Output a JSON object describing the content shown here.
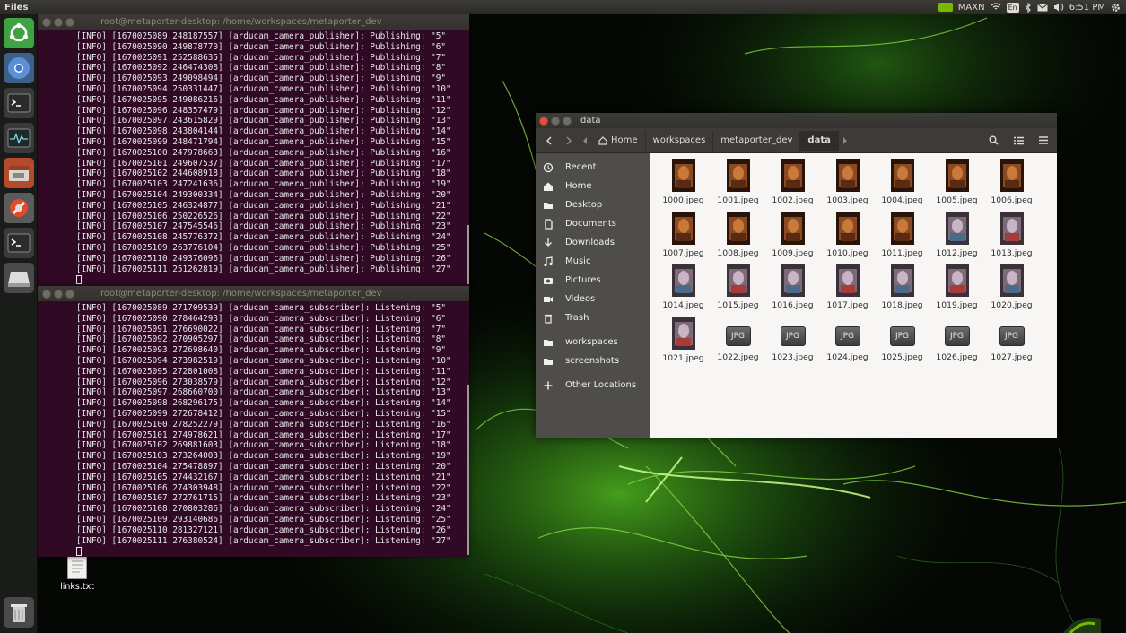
{
  "top_panel": {
    "app_name": "Files",
    "power_mode": "MAXN",
    "keyboard_layout": "En",
    "time": "6:51 PM"
  },
  "launcher": {
    "items": [
      {
        "name": "ubuntu-dash-icon",
        "color": "#3fa344"
      },
      {
        "name": "chromium-icon",
        "color": "#3d7bd9"
      },
      {
        "name": "terminal-icon",
        "color": "#2b2b2b"
      },
      {
        "name": "system-monitor-icon",
        "color": "#2b2b2b"
      },
      {
        "name": "files-icon",
        "color": "#d9613e"
      },
      {
        "name": "settings-icon",
        "color": "#e24a2a"
      },
      {
        "name": "terminal-icon-2",
        "color": "#2b2b2b"
      },
      {
        "name": "drive-icon",
        "color": "#dddddd"
      }
    ],
    "trash": "trash-icon"
  },
  "terminal_publisher": {
    "title": "root@metaporter-desktop: /home/workspaces/metaporter_dev",
    "lines": [
      "[INFO] [1670025089.248187557] [arducam_camera_publisher]: Publishing: \"5\"",
      "[INFO] [1670025090.249878770] [arducam_camera_publisher]: Publishing: \"6\"",
      "[INFO] [1670025091.252588635] [arducam_camera_publisher]: Publishing: \"7\"",
      "[INFO] [1670025092.246474308] [arducam_camera_publisher]: Publishing: \"8\"",
      "[INFO] [1670025093.249098494] [arducam_camera_publisher]: Publishing: \"9\"",
      "[INFO] [1670025094.250331447] [arducam_camera_publisher]: Publishing: \"10\"",
      "[INFO] [1670025095.249086216] [arducam_camera_publisher]: Publishing: \"11\"",
      "[INFO] [1670025096.248357479] [arducam_camera_publisher]: Publishing: \"12\"",
      "[INFO] [1670025097.243615829] [arducam_camera_publisher]: Publishing: \"13\"",
      "[INFO] [1670025098.243804144] [arducam_camera_publisher]: Publishing: \"14\"",
      "[INFO] [1670025099.248471794] [arducam_camera_publisher]: Publishing: \"15\"",
      "[INFO] [1670025100.247978663] [arducam_camera_publisher]: Publishing: \"16\"",
      "[INFO] [1670025101.249607537] [arducam_camera_publisher]: Publishing: \"17\"",
      "[INFO] [1670025102.244608918] [arducam_camera_publisher]: Publishing: \"18\"",
      "[INFO] [1670025103.247241636] [arducam_camera_publisher]: Publishing: \"19\"",
      "[INFO] [1670025104.249300334] [arducam_camera_publisher]: Publishing: \"20\"",
      "[INFO] [1670025105.246324877] [arducam_camera_publisher]: Publishing: \"21\"",
      "[INFO] [1670025106.250226526] [arducam_camera_publisher]: Publishing: \"22\"",
      "[INFO] [1670025107.247545546] [arducam_camera_publisher]: Publishing: \"23\"",
      "[INFO] [1670025108.245776372] [arducam_camera_publisher]: Publishing: \"24\"",
      "[INFO] [1670025109.263776104] [arducam_camera_publisher]: Publishing: \"25\"",
      "[INFO] [1670025110.249376096] [arducam_camera_publisher]: Publishing: \"26\"",
      "[INFO] [1670025111.251262819] [arducam_camera_publisher]: Publishing: \"27\""
    ]
  },
  "terminal_subscriber": {
    "title": "root@metaporter-desktop: /home/workspaces/metaporter_dev",
    "lines": [
      "[INFO] [1670025089.271709539] [arducam_camera_subscriber]: Listening: \"5\"",
      "[INFO] [1670025090.278464293] [arducam_camera_subscriber]: Listening: \"6\"",
      "[INFO] [1670025091.276690022] [arducam_camera_subscriber]: Listening: \"7\"",
      "[INFO] [1670025092.270905297] [arducam_camera_subscriber]: Listening: \"8\"",
      "[INFO] [1670025093.272698640] [arducam_camera_subscriber]: Listening: \"9\"",
      "[INFO] [1670025094.273982519] [arducam_camera_subscriber]: Listening: \"10\"",
      "[INFO] [1670025095.272801008] [arducam_camera_subscriber]: Listening: \"11\"",
      "[INFO] [1670025096.273038579] [arducam_camera_subscriber]: Listening: \"12\"",
      "[INFO] [1670025097.268660700] [arducam_camera_subscriber]: Listening: \"13\"",
      "[INFO] [1670025098.268296175] [arducam_camera_subscriber]: Listening: \"14\"",
      "[INFO] [1670025099.272678412] [arducam_camera_subscriber]: Listening: \"15\"",
      "[INFO] [1670025100.278252279] [arducam_camera_subscriber]: Listening: \"16\"",
      "[INFO] [1670025101.274978621] [arducam_camera_subscriber]: Listening: \"17\"",
      "[INFO] [1670025102.269881603] [arducam_camera_subscriber]: Listening: \"18\"",
      "[INFO] [1670025103.273264003] [arducam_camera_subscriber]: Listening: \"19\"",
      "[INFO] [1670025104.275478897] [arducam_camera_subscriber]: Listening: \"20\"",
      "[INFO] [1670025105.274432167] [arducam_camera_subscriber]: Listening: \"21\"",
      "[INFO] [1670025106.274303948] [arducam_camera_subscriber]: Listening: \"22\"",
      "[INFO] [1670025107.272761715] [arducam_camera_subscriber]: Listening: \"23\"",
      "[INFO] [1670025108.270803286] [arducam_camera_subscriber]: Listening: \"24\"",
      "[INFO] [1670025109.293140686] [arducam_camera_subscriber]: Listening: \"25\"",
      "[INFO] [1670025110.281327121] [arducam_camera_subscriber]: Listening: \"26\"",
      "[INFO] [1670025111.276380524] [arducam_camera_subscriber]: Listening: \"27\""
    ]
  },
  "file_manager": {
    "title": "data",
    "breadcrumbs": [
      "Home",
      "workspaces",
      "metaporter_dev",
      "data"
    ],
    "sidebar": [
      {
        "label": "Recent",
        "icon": "clock-icon"
      },
      {
        "label": "Home",
        "icon": "home-icon"
      },
      {
        "label": "Desktop",
        "icon": "folder-icon"
      },
      {
        "label": "Documents",
        "icon": "document-icon"
      },
      {
        "label": "Downloads",
        "icon": "download-icon"
      },
      {
        "label": "Music",
        "icon": "music-icon"
      },
      {
        "label": "Pictures",
        "icon": "camera-icon"
      },
      {
        "label": "Videos",
        "icon": "video-icon"
      },
      {
        "label": "Trash",
        "icon": "trash-icon"
      },
      {
        "label": "workspaces",
        "icon": "folder-icon"
      },
      {
        "label": "screenshots",
        "icon": "folder-icon"
      },
      {
        "label": "Other Locations",
        "icon": "plus-icon"
      }
    ],
    "files": [
      {
        "name": "1000.jpeg",
        "thumb": "warm"
      },
      {
        "name": "1001.jpeg",
        "thumb": "warm"
      },
      {
        "name": "1002.jpeg",
        "thumb": "warm"
      },
      {
        "name": "1003.jpeg",
        "thumb": "warm"
      },
      {
        "name": "1004.jpeg",
        "thumb": "warm"
      },
      {
        "name": "1005.jpeg",
        "thumb": "warm"
      },
      {
        "name": "1006.jpeg",
        "thumb": "warm"
      },
      {
        "name": "1007.jpeg",
        "thumb": "warm"
      },
      {
        "name": "1008.jpeg",
        "thumb": "warm"
      },
      {
        "name": "1009.jpeg",
        "thumb": "warm"
      },
      {
        "name": "1010.jpeg",
        "thumb": "warm"
      },
      {
        "name": "1011.jpeg",
        "thumb": "warm"
      },
      {
        "name": "1012.jpeg",
        "thumb": "cool"
      },
      {
        "name": "1013.jpeg",
        "thumb": "cool"
      },
      {
        "name": "1014.jpeg",
        "thumb": "cool"
      },
      {
        "name": "1015.jpeg",
        "thumb": "cool"
      },
      {
        "name": "1016.jpeg",
        "thumb": "cool"
      },
      {
        "name": "1017.jpeg",
        "thumb": "cool"
      },
      {
        "name": "1018.jpeg",
        "thumb": "cool"
      },
      {
        "name": "1019.jpeg",
        "thumb": "cool"
      },
      {
        "name": "1020.jpeg",
        "thumb": "cool"
      },
      {
        "name": "1021.jpeg",
        "thumb": "cool"
      },
      {
        "name": "1022.jpeg",
        "thumb": "JPG"
      },
      {
        "name": "1023.jpeg",
        "thumb": "JPG"
      },
      {
        "name": "1024.jpeg",
        "thumb": "JPG"
      },
      {
        "name": "1025.jpeg",
        "thumb": "JPG"
      },
      {
        "name": "1026.jpeg",
        "thumb": "JPG"
      },
      {
        "name": "1027.jpeg",
        "thumb": "JPG"
      }
    ]
  },
  "desktop": {
    "file_label": "links.txt"
  },
  "colors": {
    "terminal_bg": "#300a24",
    "accent_green": "#76b900",
    "close_button": "#e0523b"
  }
}
